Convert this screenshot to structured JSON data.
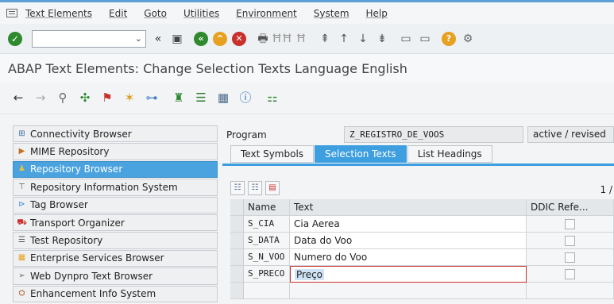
{
  "menu": [
    "Text Elements",
    "Edit",
    "Goto",
    "Utilities",
    "Environment",
    "System",
    "Help"
  ],
  "title": "ABAP Text Elements: Change Selection Texts Language English",
  "nav": [
    {
      "label": "Connectivity Browser",
      "icon": "connectivity-icon"
    },
    {
      "label": "MIME Repository",
      "icon": "mime-icon"
    },
    {
      "label": "Repository Browser",
      "icon": "repository-icon",
      "selected": true
    },
    {
      "label": "Repository Information System",
      "icon": "info-system-icon"
    },
    {
      "label": "Tag Browser",
      "icon": "tag-icon"
    },
    {
      "label": "Transport Organizer",
      "icon": "transport-icon"
    },
    {
      "label": "Test Repository",
      "icon": "test-icon"
    },
    {
      "label": "Enterprise Services Browser",
      "icon": "services-icon"
    },
    {
      "label": "Web Dynpro Text Browser",
      "icon": "webdynpro-icon"
    },
    {
      "label": "Enhancement Info System",
      "icon": "enhancement-icon"
    }
  ],
  "program": {
    "label": "Program",
    "name": "Z_REGISTRO_DE_VOOS",
    "status": "active / revised"
  },
  "tabs": [
    {
      "label": "Text Symbols"
    },
    {
      "label": "Selection Texts",
      "active": true
    },
    {
      "label": "List Headings"
    }
  ],
  "page_indicator": "1 /",
  "table": {
    "headers": [
      "Name",
      "Text",
      "DDIC Refe..."
    ],
    "rows": [
      {
        "name": "S_CIA",
        "text": "Cia Aerea"
      },
      {
        "name": "S_DATA",
        "text": "Data do Voo"
      },
      {
        "name": "S_N_VOO",
        "text": "Numero do Voo"
      },
      {
        "name": "S_PRECO",
        "text": "Preço"
      }
    ]
  },
  "colors": {
    "accent": "#3d9ee0",
    "selected_nav": "#4aa3df",
    "ok_green": "#2f8a2f"
  }
}
